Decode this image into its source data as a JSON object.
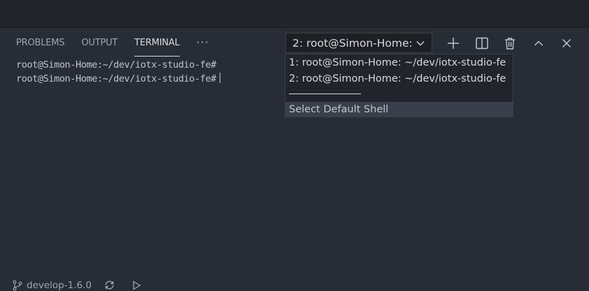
{
  "panel": {
    "tabs": [
      {
        "label": "PROBLEMS"
      },
      {
        "label": "OUTPUT"
      },
      {
        "label": "TERMINAL",
        "active": true
      }
    ],
    "more_label": "···"
  },
  "terminal_select": {
    "value": "2: root@Simon-Home:",
    "icon": "chevron-down-icon"
  },
  "toolbar": {
    "icons": [
      "plus-icon",
      "split-icon",
      "trash-icon",
      "chevron-up-icon",
      "close-icon"
    ]
  },
  "dropdown": {
    "options": [
      {
        "label": "1: root@Simon-Home: ~/dev/iotx-studio-fe"
      },
      {
        "label": "2: root@Simon-Home: ~/dev/iotx-studio-fe"
      },
      {
        "label": "Select Default Shell",
        "selected": true
      }
    ]
  },
  "terminal": {
    "lines": [
      "root@Simon-Home:~/dev/iotx-studio-fe#",
      "root@Simon-Home:~/dev/iotx-studio-fe#"
    ]
  },
  "statusbar": {
    "branch": "develop-1.6.0"
  },
  "colors": {
    "background": "#282c34",
    "topbar": "#21252b",
    "text": "#abb2bf",
    "active_text": "#d7dae0"
  }
}
